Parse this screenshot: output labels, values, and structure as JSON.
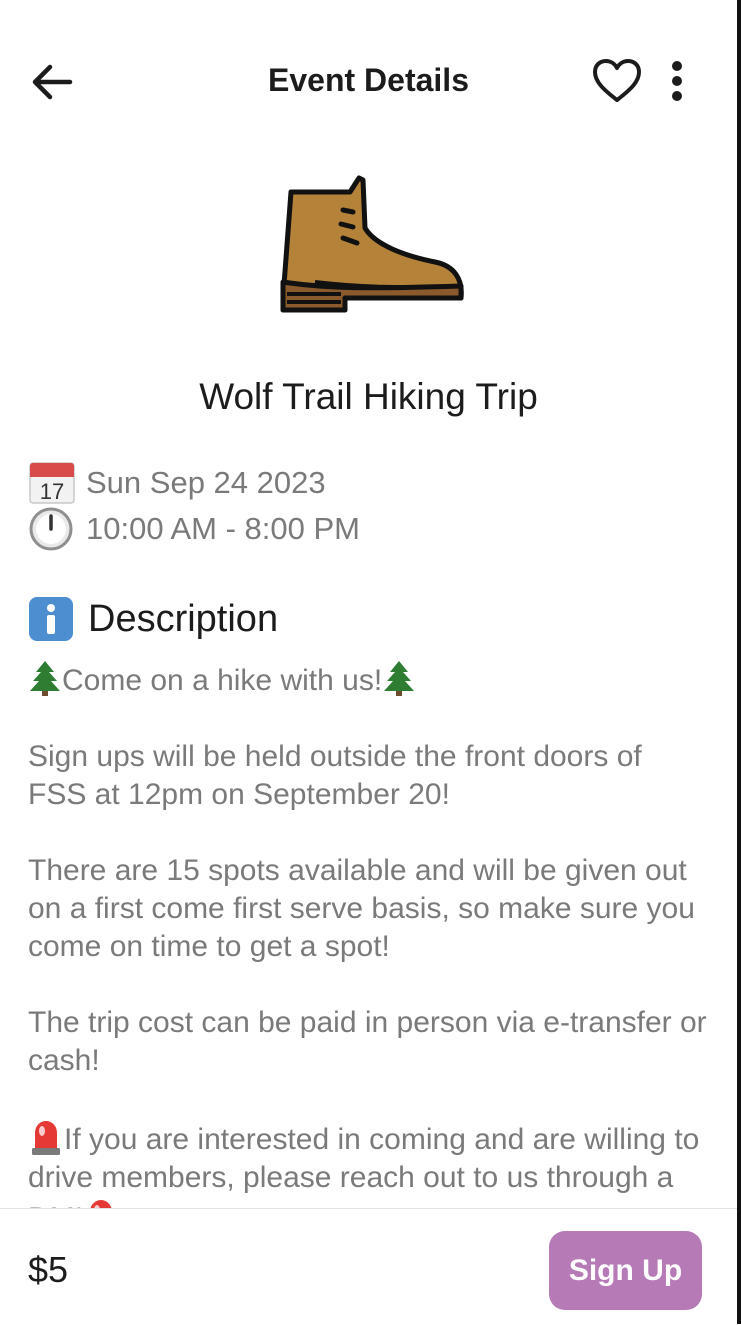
{
  "header": {
    "title": "Event Details",
    "icons": {
      "back": "arrow-left-icon",
      "favorite": "heart-outline-icon",
      "more": "more-vertical-icon"
    }
  },
  "event": {
    "icon": "hiking-boot-icon",
    "name": "Wolf Trail Hiking Trip",
    "date": "Sun Sep 24 2023",
    "time": "10:00 AM - 8:00 PM"
  },
  "description": {
    "heading": "Description",
    "paragraphs": {
      "intro": "Come on a hike with us!",
      "signups": "Sign ups will be held outside the front doors of FSS at 12pm on September 20!",
      "spots": "There are 15 spots available and will be given out on a first come first serve basis, so make sure you come on time to get a spot!",
      "payment": "The trip cost can be paid in person via e-transfer or cash!",
      "drivers": "If you are interested in coming and are willing to drive members, please reach out to us through a DM!"
    }
  },
  "footer": {
    "price": "$5",
    "signup_label": "Sign Up"
  },
  "colors": {
    "accent": "#b67ab7",
    "text_primary": "#1c1c1c",
    "text_secondary": "#7a7a7a"
  }
}
